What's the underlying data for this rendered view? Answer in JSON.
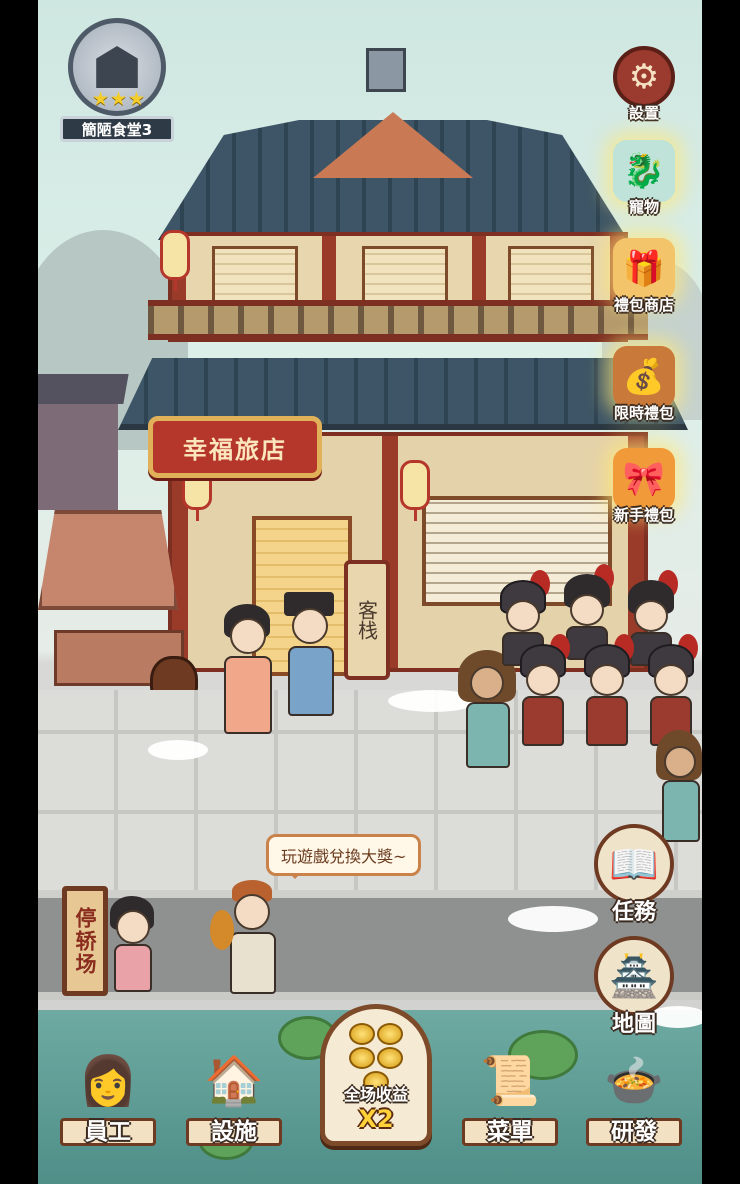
{
  "restaurant": {
    "name": "簡陋食堂3",
    "stars": "★★★"
  },
  "inn": {
    "sign": "幸福旅店",
    "side_sign": "客栈"
  },
  "sedan_sign": "停轿场",
  "speech_bubble": "玩遊戲兌換大獎~",
  "side_menu": {
    "settings": "設置",
    "pets": "寵物",
    "gift_shop": "禮包商店",
    "limited_gift": "限時禮包",
    "newbie_gift": "新手禮包"
  },
  "right_actions": {
    "tasks": "任務",
    "map": "地圖"
  },
  "bottom_nav": {
    "staff": "員工",
    "facilities": "設施",
    "bonus_label": "全场收益",
    "bonus_multiplier": "X2",
    "menu": "菜單",
    "research": "研發"
  },
  "colors": {
    "accent_red": "#b5362a",
    "roof_blue": "#3d5566",
    "wood_brown": "#6e3a22",
    "gold": "#ffd23a"
  },
  "icons": {
    "settings": "gear-icon",
    "pets": "dragon-icon",
    "gift_shop": "gift-pile-icon",
    "limited_gift": "treasure-chest-icon",
    "newbie_gift": "gift-box-icon",
    "tasks": "scroll-book-icon",
    "map": "pavilion-icon",
    "staff": "waitress-icon",
    "facilities": "building-icon",
    "menu": "menu-scroll-icon",
    "research": "stove-icon"
  }
}
